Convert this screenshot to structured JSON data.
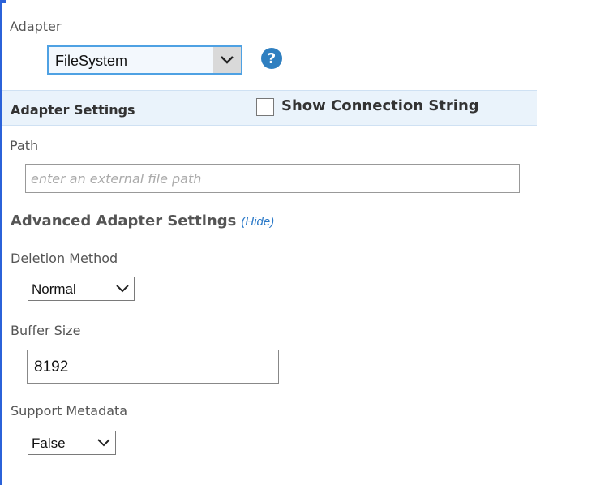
{
  "adapter": {
    "label": "Adapter",
    "selected": "FileSystem",
    "help_icon": "help-icon"
  },
  "settings": {
    "title": "Adapter Settings",
    "show_connection_string_label": "Show Connection String",
    "show_connection_string_checked": false
  },
  "path": {
    "label": "Path",
    "placeholder": "enter an external file path",
    "value": ""
  },
  "advanced": {
    "title": "Advanced Adapter Settings",
    "hide_link": "(Hide)"
  },
  "deletion_method": {
    "label": "Deletion Method",
    "selected": "Normal"
  },
  "buffer_size": {
    "label": "Buffer Size",
    "value": "8192"
  },
  "support_metadata": {
    "label": "Support Metadata",
    "selected": "False"
  },
  "colors": {
    "accent_blue": "#2b62d9",
    "help_icon_blue": "#2f7fc0",
    "settings_bar_bg": "#eaf3fb",
    "link_blue": "#2a79c8"
  }
}
